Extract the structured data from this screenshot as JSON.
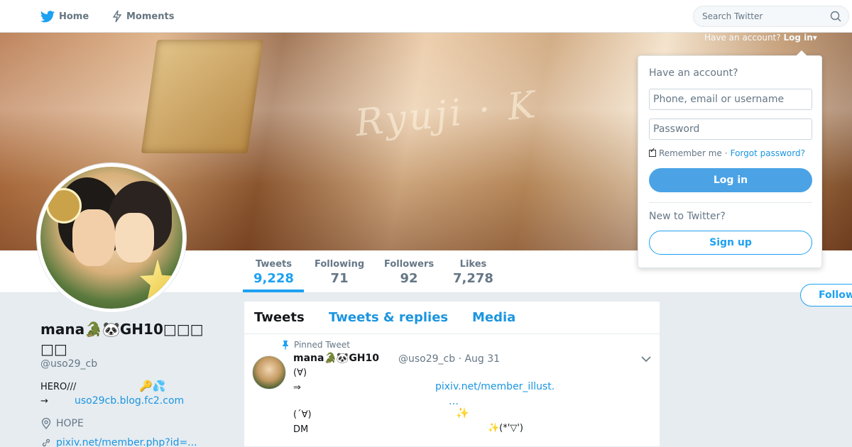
{
  "nav": {
    "home_label": "Home",
    "moments_label": "Moments",
    "search_placeholder": "Search Twitter"
  },
  "account_hint": {
    "prompt": "Have an account?",
    "login": "Log in"
  },
  "login_dropdown": {
    "title": "Have an account?",
    "username_placeholder": "Phone, email or username",
    "password_placeholder": "Password",
    "remember_label": "Remember me",
    "separator": "·",
    "forgot_label": "Forgot password?",
    "login_button": "Log in",
    "new_prompt": "New to Twitter?",
    "signup_button": "Sign up"
  },
  "stats": [
    {
      "label": "Tweets",
      "value": "9,228"
    },
    {
      "label": "Following",
      "value": "71"
    },
    {
      "label": "Followers",
      "value": "92"
    },
    {
      "label": "Likes",
      "value": "7,278"
    }
  ],
  "follow_button": "Follow",
  "profile": {
    "name_line1": "mana🐊🐼GH10□□□",
    "name_line2": "□□",
    "screen_name": "@uso29_cb",
    "bio_line1": "HERO///",
    "bio_emoji": "🔑💦",
    "bio_arrow": "→",
    "bio_link": "uso29cb.blog.fc2.com",
    "location": "HOPE",
    "url": "pixiv.net/member.php?id=..."
  },
  "timeline": {
    "tabs": [
      "Tweets",
      "Tweets & replies",
      "Media"
    ],
    "pinned_label": "Pinned Tweet",
    "tweet": {
      "name": "mana🐊🐼GH10",
      "handle_date": "@uso29_cb · Aug 31",
      "line1": "(∀)",
      "line2": "⇒",
      "link": "pixiv.net/member_illust.",
      "ellipsis": "…",
      "line3": "(´∀)",
      "line4": "DM",
      "sparkle1": "✨",
      "sparkle2": "✨(*'▽')"
    }
  },
  "colors": {
    "accent": "#1da1f2",
    "link": "#1b95e0",
    "muted": "#657786",
    "background": "#e6ecf0"
  }
}
